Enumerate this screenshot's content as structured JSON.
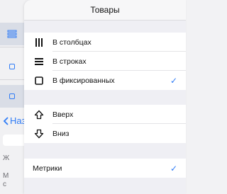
{
  "background": {
    "back_label": "Наз",
    "text_1": "Ж",
    "text_2_line1": "М",
    "text_2_line2": "с"
  },
  "popover": {
    "title": "Товары",
    "layout_group": [
      {
        "label": "В столбцах",
        "icon": "columns-icon",
        "checked": false
      },
      {
        "label": "В строках",
        "icon": "rows-icon",
        "checked": false
      },
      {
        "label": "В фиксированных",
        "icon": "square-icon",
        "checked": true
      }
    ],
    "move_group": [
      {
        "label": "Вверх",
        "icon": "arrow-up-icon"
      },
      {
        "label": "Вниз",
        "icon": "arrow-down-icon"
      }
    ],
    "metrics": {
      "label": "Метрики",
      "checked": true
    },
    "checkmark": "✓",
    "accent_color": "#2f7cf6"
  }
}
